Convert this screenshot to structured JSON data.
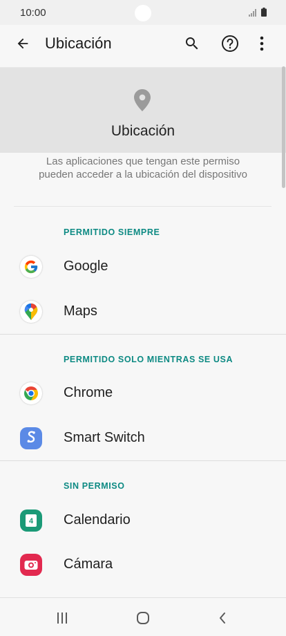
{
  "status_bar": {
    "time": "10:00"
  },
  "app_bar": {
    "title": "Ubicación"
  },
  "header": {
    "title": "Ubicación"
  },
  "description": "Las aplicaciones que tengan este permiso pueden acceder a la ubicación del dispositivo",
  "sections": [
    {
      "title": "PERMITIDO SIEMPRE",
      "apps": [
        {
          "label": "Google",
          "icon": "google-icon"
        },
        {
          "label": "Maps",
          "icon": "maps-icon"
        }
      ]
    },
    {
      "title": "PERMITIDO SOLO MIENTRAS SE USA",
      "apps": [
        {
          "label": "Chrome",
          "icon": "chrome-icon"
        },
        {
          "label": "Smart Switch",
          "icon": "smart-switch-icon"
        }
      ]
    },
    {
      "title": "SIN PERMISO",
      "apps": [
        {
          "label": "Calendario",
          "icon": "calendar-icon",
          "badge": "4"
        },
        {
          "label": "Cámara",
          "icon": "camera-icon"
        }
      ]
    }
  ],
  "colors": {
    "accent": "#0d8a83",
    "header_bg": "#e3e3e3",
    "page_bg": "#f7f7f7"
  }
}
